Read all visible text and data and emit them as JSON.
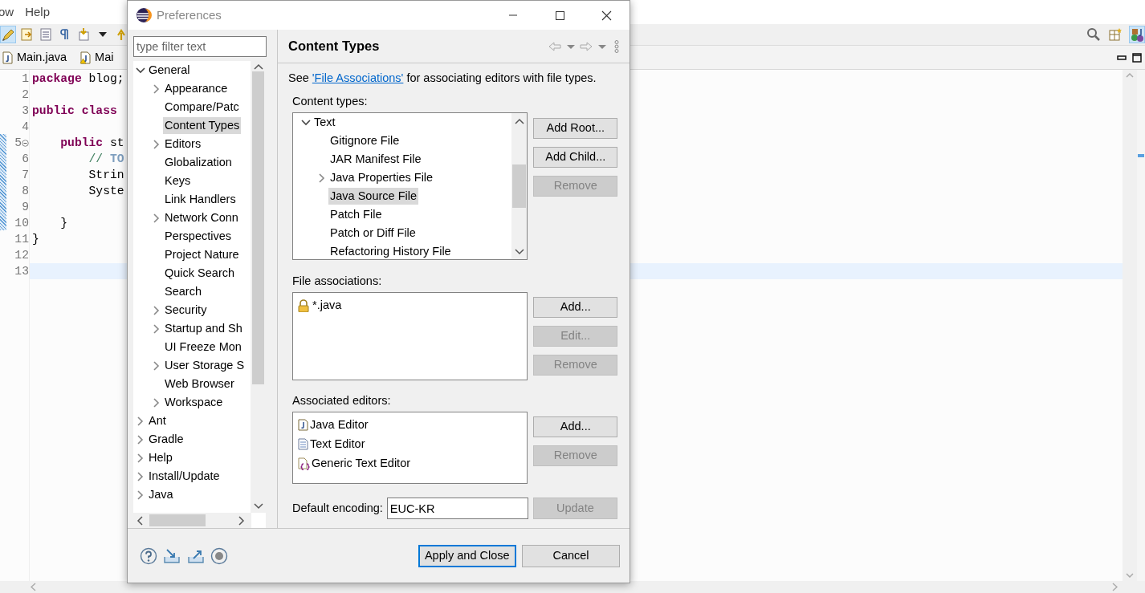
{
  "ide": {
    "menu": [
      "ow",
      "Help"
    ],
    "editor_tabs": [
      {
        "label": "Main.java",
        "kind": "java"
      },
      {
        "label": "Mai",
        "kind": "java-warning"
      }
    ],
    "code_lines": [
      {
        "number": "1",
        "text": "**package** blog;",
        "kind": "code",
        "current": false
      },
      {
        "number": "2",
        "kind": "code",
        "current": false
      },
      {
        "number": "3",
        "text": "**public** **class**",
        "kind": "code",
        "current": false
      },
      {
        "number": "4",
        "kind": "code",
        "current": false
      },
      {
        "number": "5",
        "text": "    **public** st",
        "kind": "code",
        "current": false
      },
      {
        "number": "6",
        "text": "        // **TO**",
        "kind": "comment",
        "current": false
      },
      {
        "number": "7",
        "text": "        Strin",
        "kind": "code",
        "current": false
      },
      {
        "number": "8",
        "text": "        Syste",
        "kind": "code",
        "current": false
      },
      {
        "number": "9",
        "kind": "code",
        "current": false
      },
      {
        "number": "10",
        "text": "    }",
        "kind": "code",
        "current": false
      },
      {
        "number": "11",
        "text": "}",
        "kind": "code",
        "current": false
      },
      {
        "number": "12",
        "kind": "code",
        "current": false
      },
      {
        "number": "13",
        "kind": "code",
        "current": true
      }
    ]
  },
  "dialog": {
    "title": "Preferences",
    "filter": {
      "placeholder": "type filter text"
    },
    "nav_tree": [
      {
        "label": "General",
        "kind": "branch",
        "expanded": true,
        "selected": false,
        "children": [
          {
            "label": "Appearance",
            "kind": "branch",
            "expanded": false,
            "selected": false
          },
          {
            "label": "Compare/Patc",
            "kind": "leaf",
            "selected": false
          },
          {
            "label": "Content Types",
            "kind": "leaf",
            "selected": true
          },
          {
            "label": "Editors",
            "kind": "branch",
            "expanded": false,
            "selected": false
          },
          {
            "label": "Globalization",
            "kind": "leaf",
            "selected": false
          },
          {
            "label": "Keys",
            "kind": "leaf",
            "selected": false
          },
          {
            "label": "Link Handlers",
            "kind": "leaf",
            "selected": false
          },
          {
            "label": "Network Conn",
            "kind": "branch",
            "expanded": false,
            "selected": false
          },
          {
            "label": "Perspectives",
            "kind": "leaf",
            "selected": false
          },
          {
            "label": "Project Nature",
            "kind": "leaf",
            "selected": false
          },
          {
            "label": "Quick Search",
            "kind": "leaf",
            "selected": false
          },
          {
            "label": "Search",
            "kind": "leaf",
            "selected": false
          },
          {
            "label": "Security",
            "kind": "branch",
            "expanded": false,
            "selected": false
          },
          {
            "label": "Startup and Sh",
            "kind": "branch",
            "expanded": false,
            "selected": false
          },
          {
            "label": "UI Freeze Mon",
            "kind": "leaf",
            "selected": false
          },
          {
            "label": "User Storage S",
            "kind": "branch",
            "expanded": false,
            "selected": false
          },
          {
            "label": "Web Browser",
            "kind": "leaf",
            "selected": false
          },
          {
            "label": "Workspace",
            "kind": "branch",
            "expanded": false,
            "selected": false
          }
        ]
      },
      {
        "label": "Ant",
        "kind": "branch",
        "expanded": false,
        "selected": false
      },
      {
        "label": "Gradle",
        "kind": "branch",
        "expanded": false,
        "selected": false
      },
      {
        "label": "Help",
        "kind": "branch",
        "expanded": false,
        "selected": false
      },
      {
        "label": "Install/Update",
        "kind": "branch",
        "expanded": false,
        "selected": false
      },
      {
        "label": "Java",
        "kind": "branch",
        "expanded": false,
        "selected": false
      }
    ],
    "page": {
      "title": "Content Types",
      "intro": {
        "before": "See ",
        "link": "'File Associations'",
        "after": " for associating editors with file types."
      },
      "content_types": {
        "label": "Content types:",
        "tree": [
          {
            "label": "Text",
            "kind": "branch",
            "expanded": true,
            "selected": false,
            "children": [
              {
                "label": "Gitignore File",
                "kind": "leaf",
                "selected": false
              },
              {
                "label": "JAR Manifest File",
                "kind": "leaf",
                "selected": false
              },
              {
                "label": "Java Properties File",
                "kind": "branch",
                "expanded": false,
                "selected": false
              },
              {
                "label": "Java Source File",
                "kind": "leaf",
                "selected": true
              },
              {
                "label": "Patch File",
                "kind": "leaf",
                "selected": false
              },
              {
                "label": "Patch or Diff File",
                "kind": "leaf",
                "selected": false
              },
              {
                "label": "Refactoring History File",
                "kind": "leaf",
                "selected": false
              }
            ]
          }
        ],
        "buttons": [
          {
            "label": "Add Root...",
            "disabled": false
          },
          {
            "label": "Add Child...",
            "disabled": false
          },
          {
            "label": "Remove",
            "disabled": true
          }
        ]
      },
      "file_associations": {
        "label": "File associations:",
        "items": [
          {
            "label": "*.java",
            "kind": "locked"
          }
        ],
        "buttons": [
          {
            "label": "Add...",
            "disabled": false
          },
          {
            "label": "Edit...",
            "disabled": true
          },
          {
            "label": "Remove",
            "disabled": true
          }
        ]
      },
      "associated_editors": {
        "label": "Associated editors:",
        "items": [
          {
            "label": "Java Editor",
            "kind": "java"
          },
          {
            "label": "Text Editor",
            "kind": "text"
          },
          {
            "label": "Generic Text Editor",
            "kind": "generic"
          }
        ],
        "buttons": [
          {
            "label": "Add...",
            "disabled": false
          },
          {
            "label": "Remove",
            "disabled": true
          }
        ]
      },
      "encoding": {
        "label": "Default encoding:",
        "value": "EUC-KR",
        "button": {
          "label": "Update",
          "disabled": true
        }
      }
    },
    "footer_buttons": [
      {
        "label": "Apply and Close",
        "default": true
      },
      {
        "label": "Cancel",
        "default": false
      }
    ]
  }
}
